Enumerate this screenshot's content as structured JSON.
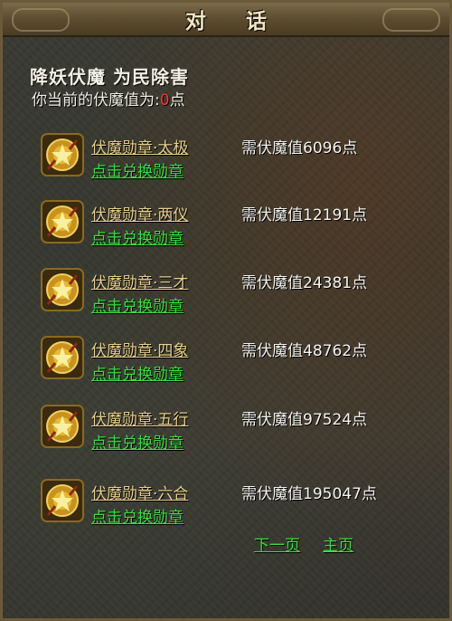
{
  "dialog": {
    "title": "对 话",
    "header": "降妖伏魔 为民除害",
    "points_prefix": "你当前的伏魔值为:",
    "points_value": "0",
    "points_suffix": "点",
    "colors": {
      "link_green": "#39e040",
      "medal_gold": "#e8cf8c",
      "value_red": "#ff3030"
    }
  },
  "medals": [
    {
      "name": "伏魔勋章·太极",
      "requirement": "需伏魔值6096点",
      "action": "点击兑换勋章",
      "icon": "medal-icon"
    },
    {
      "name": "伏魔勋章·两仪",
      "requirement": "需伏魔值12191点",
      "action": "点击兑换勋章",
      "icon": "medal-icon"
    },
    {
      "name": "伏魔勋章·三才",
      "requirement": "需伏魔值24381点",
      "action": "点击兑换勋章",
      "icon": "medal-icon"
    },
    {
      "name": "伏魔勋章·四象",
      "requirement": "需伏魔值48762点",
      "action": "点击兑换勋章",
      "icon": "medal-icon"
    },
    {
      "name": "伏魔勋章·五行",
      "requirement": "需伏魔值97524点",
      "action": "点击兑换勋章",
      "icon": "medal-icon"
    },
    {
      "name": "伏魔勋章·六合",
      "requirement": "需伏魔值195047点",
      "action": "点击兑换勋章",
      "icon": "medal-icon"
    }
  ],
  "nav": {
    "next_page": "下一页",
    "home": "主页"
  }
}
